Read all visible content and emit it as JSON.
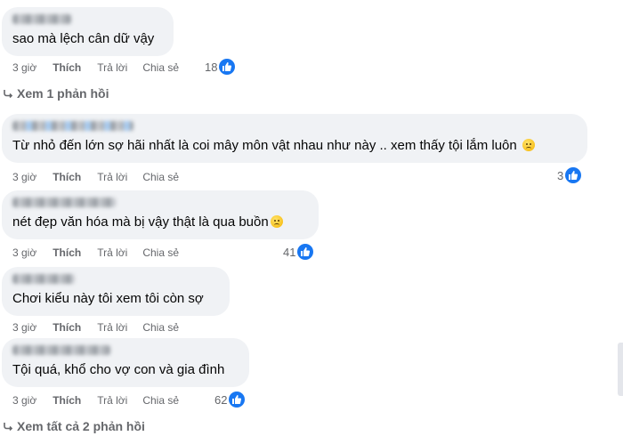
{
  "colors": {
    "bubble": "#f0f2f5",
    "meta_text": "#65676b",
    "like_blue": "#1877f2",
    "text": "#050505"
  },
  "actions": {
    "like": "Thích",
    "reply": "Trả lời",
    "share": "Chia sẻ"
  },
  "comments": [
    {
      "text": "sao mà lệch cân dữ vậy",
      "emoji": "",
      "time": "3 giờ",
      "reactions": "18"
    },
    {
      "text": "Từ nhỏ đến lớn sợ hãi nhất là coi mây môn vật nhau như này .. xem thấy tội lắm luôn",
      "emoji": "sad-face-emoji",
      "time": "3 giờ",
      "reactions": "3"
    },
    {
      "text": "nét đẹp văn hóa mà bị vậy thật là qua buồn",
      "emoji": "disappointed-face-emoji",
      "time": "3 giờ",
      "reactions": "41"
    },
    {
      "text": "Chơi kiểu này tôi xem tôi còn sợ",
      "emoji": "",
      "time": "3 giờ",
      "reactions": ""
    },
    {
      "text": "Tội quá, khổ cho vợ con và gia đình",
      "emoji": "",
      "time": "3 giờ",
      "reactions": "62"
    }
  ],
  "view_replies_1": "Xem 1 phản hồi",
  "view_replies_2": "Xem tất cả 2 phản hồi",
  "icons": {
    "like_badge": "thumbs-up-icon",
    "reply_arrow": "reply-arrow-icon"
  }
}
